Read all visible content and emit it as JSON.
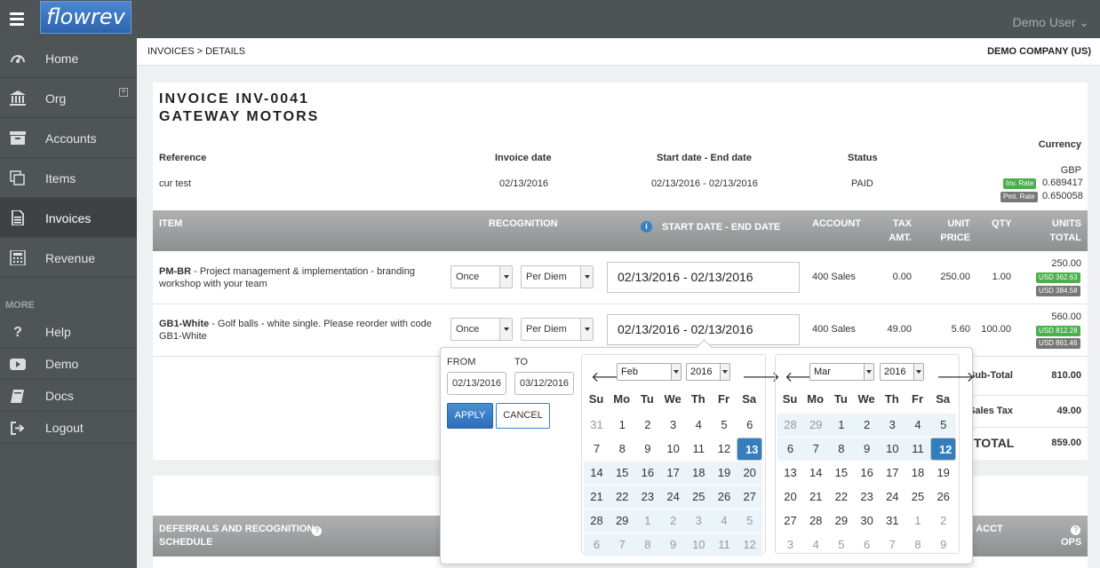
{
  "app": {
    "logo": "flowrev",
    "user_menu": "Demo User ⌄"
  },
  "nav": {
    "items": [
      {
        "label": "Home"
      },
      {
        "label": "Org"
      },
      {
        "label": "Accounts"
      },
      {
        "label": "Items"
      },
      {
        "label": "Invoices"
      },
      {
        "label": "Revenue"
      }
    ],
    "more_label": "MORE",
    "more_items": [
      {
        "label": "Help"
      },
      {
        "label": "Demo"
      },
      {
        "label": "Docs"
      },
      {
        "label": "Logout"
      }
    ]
  },
  "breadcrumb": "INVOICES > DETAILS",
  "company": "DEMO COMPANY (US)",
  "invoice": {
    "title": "INVOICE INV-0041",
    "customer": "GATEWAY MOTORS",
    "headers": {
      "reference": "Reference",
      "invoice_date": "Invoice date",
      "range": "Start date - End date",
      "status": "Status",
      "currency": "Currency"
    },
    "values": {
      "reference": "cur test",
      "invoice_date": "02/13/2016",
      "range": "02/13/2016 - 02/13/2016",
      "status": "PAID",
      "currency": "GBP"
    },
    "inv_rate_label": "Inv. Rate",
    "inv_rate": "0.689417",
    "pmt_rate_label": "Pmt. Rate",
    "pmt_rate": "0.650058"
  },
  "table": {
    "cols": {
      "item": "ITEM",
      "recognition": "RECOGNITION",
      "range": "START DATE - END DATE",
      "account": "ACCOUNT",
      "tax1": "TAX",
      "tax2": "AMT.",
      "unit1": "UNIT",
      "unit2": "PRICE",
      "qty": "QTY",
      "units1": "UNITS",
      "units2": "TOTAL"
    },
    "rows": [
      {
        "code": "PM-BR",
        "desc": " - Project management & implementation - branding workshop with your team",
        "recog": "Once",
        "method": "Per Diem",
        "range": "02/13/2016 - 02/13/2016",
        "account": "400 Sales",
        "tax": "0.00",
        "price": "250.00",
        "qty": "1.00",
        "total": "250.00",
        "usd1": "USD 362.63",
        "usd2": "USD 384.58"
      },
      {
        "code": "GB1-White",
        "desc": " - Golf balls - white single. Please reorder with code GB1-White",
        "recog": "Once",
        "method": "Per Diem",
        "range": "02/13/2016 - 02/13/2016",
        "account": "400 Sales",
        "tax": "49.00",
        "price": "5.60",
        "qty": "100.00",
        "total": "560.00",
        "usd1": "USD 812.28",
        "usd2": "USD 861.46"
      }
    ]
  },
  "totals": {
    "subtotal_label": "Sub-Total",
    "subtotal": "810.00",
    "tax_label": "Sales Tax",
    "tax": "49.00",
    "total_label": "TOTAL",
    "total": "859.00"
  },
  "schedule": {
    "title1": "DEFERRALS AND RECOGNITION",
    "title2": "SCHEDULE",
    "col_acct": "O ACCT",
    "col_ops": "OPS"
  },
  "picker": {
    "from_label": "FROM",
    "to_label": "TO",
    "from": "02/13/2016",
    "to": "03/12/2016",
    "apply": "APPLY",
    "cancel": "CANCEL",
    "dows": [
      "Su",
      "Mo",
      "Tu",
      "We",
      "Th",
      "Fr",
      "Sa"
    ],
    "left": {
      "month": "Feb",
      "year": "2016",
      "days": [
        [
          "31",
          "off",
          ""
        ],
        [
          "1",
          "",
          ""
        ],
        [
          "2",
          "",
          ""
        ],
        [
          "3",
          "",
          ""
        ],
        [
          "4",
          "",
          ""
        ],
        [
          "5",
          "",
          ""
        ],
        [
          "6",
          "",
          ""
        ],
        [
          "7",
          "",
          ""
        ],
        [
          "8",
          "",
          ""
        ],
        [
          "9",
          "",
          ""
        ],
        [
          "10",
          "",
          ""
        ],
        [
          "11",
          "",
          ""
        ],
        [
          "12",
          "",
          ""
        ],
        [
          "13",
          "",
          "sel"
        ],
        [
          "14",
          "",
          "in"
        ],
        [
          "15",
          "",
          "in"
        ],
        [
          "16",
          "",
          "in"
        ],
        [
          "17",
          "",
          "in"
        ],
        [
          "18",
          "",
          "in"
        ],
        [
          "19",
          "",
          "in"
        ],
        [
          "20",
          "",
          "in"
        ],
        [
          "21",
          "",
          "in"
        ],
        [
          "22",
          "",
          "in"
        ],
        [
          "23",
          "",
          "in"
        ],
        [
          "24",
          "",
          "in"
        ],
        [
          "25",
          "",
          "in"
        ],
        [
          "26",
          "",
          "in"
        ],
        [
          "27",
          "",
          "in"
        ],
        [
          "28",
          "",
          "in"
        ],
        [
          "29",
          "",
          "in"
        ],
        [
          "1",
          "off",
          "in"
        ],
        [
          "2",
          "off",
          "in"
        ],
        [
          "3",
          "off",
          "in"
        ],
        [
          "4",
          "off",
          "in"
        ],
        [
          "5",
          "off",
          "in"
        ],
        [
          "6",
          "off",
          "in"
        ],
        [
          "7",
          "off",
          "in"
        ],
        [
          "8",
          "off",
          "in"
        ],
        [
          "9",
          "off",
          "in"
        ],
        [
          "10",
          "off",
          "in"
        ],
        [
          "11",
          "off",
          "in"
        ],
        [
          "12",
          "off",
          "in"
        ]
      ]
    },
    "right": {
      "month": "Mar",
      "year": "2016",
      "days": [
        [
          "28",
          "off",
          "in"
        ],
        [
          "29",
          "off",
          "in"
        ],
        [
          "1",
          "",
          "in"
        ],
        [
          "2",
          "",
          "in"
        ],
        [
          "3",
          "",
          "in"
        ],
        [
          "4",
          "",
          "in"
        ],
        [
          "5",
          "",
          "in"
        ],
        [
          "6",
          "",
          "in"
        ],
        [
          "7",
          "",
          "in"
        ],
        [
          "8",
          "",
          "in"
        ],
        [
          "9",
          "",
          "in"
        ],
        [
          "10",
          "",
          "in"
        ],
        [
          "11",
          "",
          "in"
        ],
        [
          "12",
          "",
          "sel"
        ],
        [
          "13",
          "",
          ""
        ],
        [
          "14",
          "",
          ""
        ],
        [
          "15",
          "",
          ""
        ],
        [
          "16",
          "",
          ""
        ],
        [
          "17",
          "",
          ""
        ],
        [
          "18",
          "",
          ""
        ],
        [
          "19",
          "",
          ""
        ],
        [
          "20",
          "",
          ""
        ],
        [
          "21",
          "",
          ""
        ],
        [
          "22",
          "",
          ""
        ],
        [
          "23",
          "",
          ""
        ],
        [
          "24",
          "",
          ""
        ],
        [
          "25",
          "",
          ""
        ],
        [
          "26",
          "",
          ""
        ],
        [
          "27",
          "",
          ""
        ],
        [
          "28",
          "",
          ""
        ],
        [
          "29",
          "",
          ""
        ],
        [
          "30",
          "",
          ""
        ],
        [
          "31",
          "",
          ""
        ],
        [
          "1",
          "off",
          ""
        ],
        [
          "2",
          "off",
          ""
        ],
        [
          "3",
          "off",
          ""
        ],
        [
          "4",
          "off",
          ""
        ],
        [
          "5",
          "off",
          ""
        ],
        [
          "6",
          "off",
          ""
        ],
        [
          "7",
          "off",
          ""
        ],
        [
          "8",
          "off",
          ""
        ],
        [
          "9",
          "off",
          ""
        ]
      ]
    }
  }
}
